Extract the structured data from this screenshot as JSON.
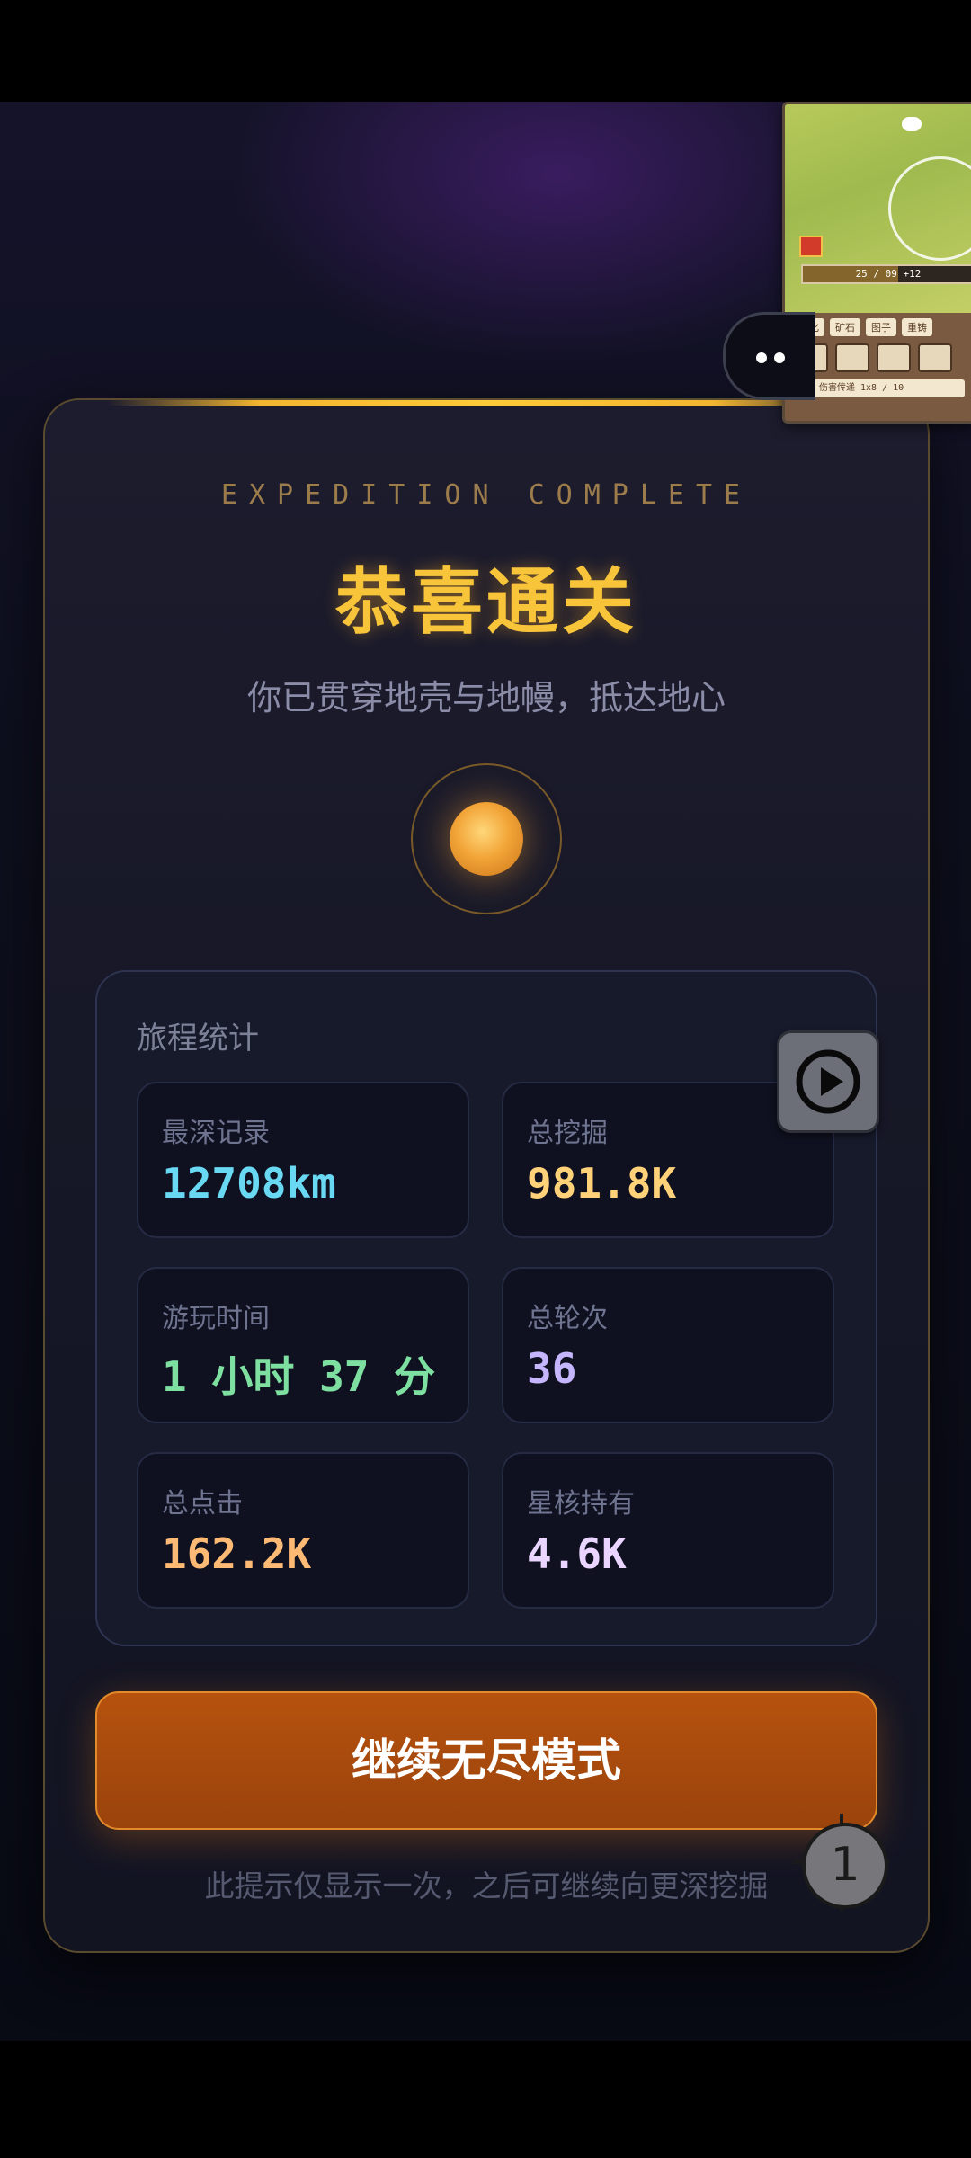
{
  "card": {
    "eyebrow": "EXPEDITION COMPLETE",
    "title": "恭喜通关",
    "subtitle": "你已贯穿地壳与地幔，抵达地心"
  },
  "stats": {
    "title": "旅程统计",
    "items": [
      {
        "label": "最深记录",
        "value": "12708km",
        "color": "#69d8f2"
      },
      {
        "label": "总挖掘",
        "value": "981.8K",
        "color": "#ffd27a"
      },
      {
        "label": "游玩时间",
        "value": "1 小时 37 分",
        "color": "#7ee0a0"
      },
      {
        "label": "总轮次",
        "value": "36",
        "color": "#c4b5fd"
      },
      {
        "label": "总点击",
        "value": "162.2K",
        "color": "#fdba74"
      },
      {
        "label": "星核持有",
        "value": "4.6K",
        "color": "#e9d5ff"
      }
    ]
  },
  "cta": {
    "label": "继续无尽模式"
  },
  "hint": "此提示仅显示一次，之后可继续向更深挖掘",
  "cursor_badge": "1",
  "mini_preview": {
    "bar_text": "25 / 09 +12",
    "tabs": [
      "强化",
      "矿石",
      "图子",
      "重铸"
    ],
    "row_text": "伤害传递 1x8 / 10"
  },
  "colors": {
    "accent": "#f8c43a",
    "cta": "#b6520e"
  }
}
